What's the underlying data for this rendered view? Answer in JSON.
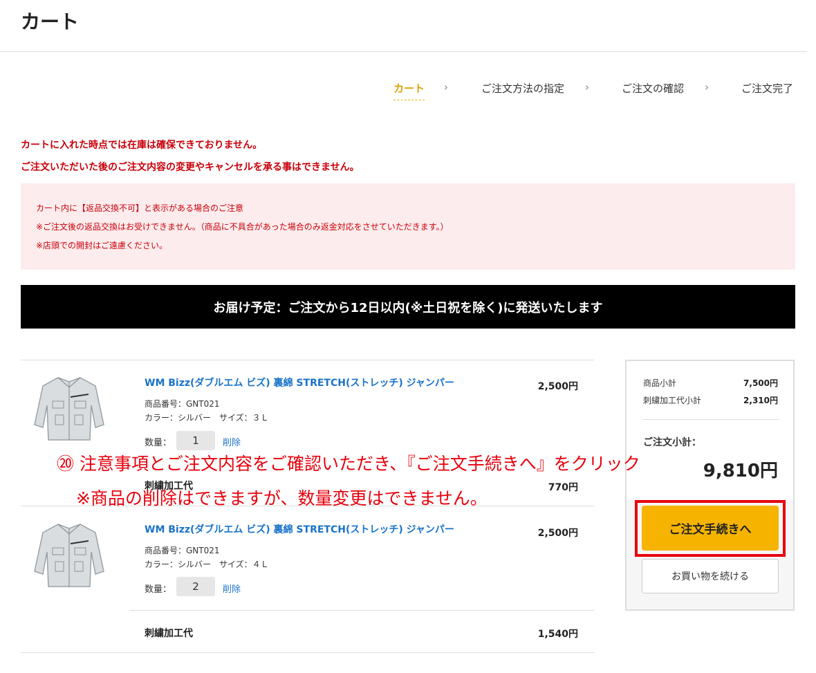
{
  "page": {
    "title": "カート"
  },
  "steps": [
    {
      "label": "カート",
      "active": true
    },
    {
      "label": "ご注文方法の指定",
      "active": false
    },
    {
      "label": "ご注文の確認",
      "active": false
    },
    {
      "label": "ご注文完了",
      "active": false
    }
  ],
  "warnings": [
    "カートに入れた時点では在庫は確保できておりません。",
    "ご注文いただいた後のご注文内容の変更やキャンセルを承る事はできません。"
  ],
  "notice": {
    "lines": [
      "カート内に【返品交換不可】と表示がある場合のご注意",
      "※ご注文後の返品交換はお受けできません。（商品に不具合があった場合のみ返金対応をさせていただきます。）",
      "※店頭での開封はご遠慮ください。"
    ]
  },
  "delivery": {
    "text": "お届け予定：ご注文から12日以内(※土日祝を除く)に発送いたします"
  },
  "cart": {
    "qty_label": "数量：",
    "delete_label": "削除",
    "items": [
      {
        "name": "WM Bizz(ダブルエム ビズ) 裏綿 STRETCH(ストレッチ) ジャンパー",
        "product_code": "商品番号：GNT021",
        "variant": "カラー：シルバー　サイズ：３Ｌ",
        "quantity": "1",
        "price": "2,500円",
        "embroidery_label": "刺繍加工代",
        "embroidery_price": "770円"
      },
      {
        "name": "WM Bizz(ダブルエム ビズ) 裏綿 STRETCH(ストレッチ) ジャンパー",
        "product_code": "商品番号：GNT021",
        "variant": "カラー：シルバー　サイズ：４Ｌ",
        "quantity": "2",
        "price": "2,500円",
        "embroidery_label": "刺繍加工代",
        "embroidery_price": "1,540円"
      }
    ]
  },
  "summary": {
    "items_subtotal_label": "商品小計",
    "items_subtotal_value": "7,500円",
    "embroidery_subtotal_label": "刺繍加工代小計",
    "embroidery_subtotal_value": "2,310円",
    "order_subtotal_label": "ご注文小計：",
    "order_subtotal_value": "9,810円",
    "checkout_label": "ご注文手続きへ",
    "continue_label": "お買い物を続ける"
  },
  "annotation": {
    "line1": "⑳ 注意事項とご注文内容をご確認いただき、『ご注文手続きへ』をクリック",
    "line2": "※商品の削除はできますが、数量変更はできません。",
    "color": "#e8000c"
  },
  "colors": {
    "accent": "#f6b400",
    "warning": "#c8000a",
    "link": "#1a73c9"
  }
}
